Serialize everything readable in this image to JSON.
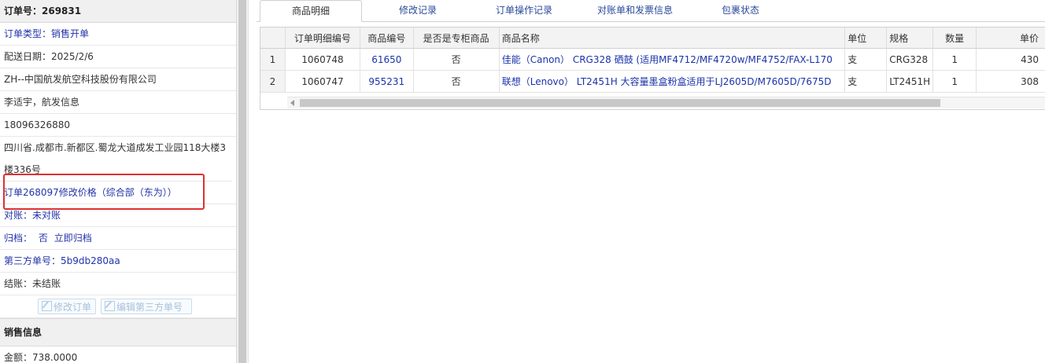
{
  "left": {
    "order_no": "订单号：269831",
    "order_type": "订单类型：销售开单",
    "delivery_date": "配送日期：2025/2/6",
    "company": "ZH--中国航发航空科技股份有限公司",
    "contact": "李适宇，航发信息",
    "phone": "18096326880",
    "address": "四川省.成都市.新都区.蜀龙大道成发工业园118大楼3楼336号",
    "price_change": "订单268097修改价格（综合部（东为））",
    "reconcile": "对账：未对账",
    "archive_label": "归档：",
    "archive_value": "否",
    "archive_link": "立即归档",
    "third_party": "第三方单号：5b9db280aa",
    "settle": "结账：未结账",
    "btn_edit_order": "修改订单",
    "btn_edit_third": "编辑第三方单号",
    "sales_section": "销售信息",
    "amount": "金额：738.0000"
  },
  "tabs": [
    "商品明细",
    "修改记录",
    "订单操作记录",
    "对账单和发票信息",
    "包裹状态"
  ],
  "grid": {
    "headers": [
      "订单明细编号",
      "商品编号",
      "是否是专柜商品",
      "商品名称",
      "单位",
      "规格",
      "数量",
      "单价"
    ],
    "rows": [
      {
        "rn": "1",
        "detail_no": "1060748",
        "goods_no": "61650",
        "counter": "否",
        "name": "佳能（Canon） CRG328 硒鼓 (适用MF4712/MF4720w/MF4752/FAX-L170",
        "unit": "支",
        "spec": "CRG328",
        "qty": "1",
        "price": "430"
      },
      {
        "rn": "2",
        "detail_no": "1060747",
        "goods_no": "955231",
        "counter": "否",
        "name": "联想（Lenovo） LT2451H 大容量墨盒粉盒适用于LJ2605D/M7605D/7675D",
        "unit": "支",
        "spec": "LT2451H",
        "qty": "1",
        "price": "308"
      }
    ]
  },
  "colors": {
    "highlight": "#e03030",
    "link": "#1a33aa"
  }
}
